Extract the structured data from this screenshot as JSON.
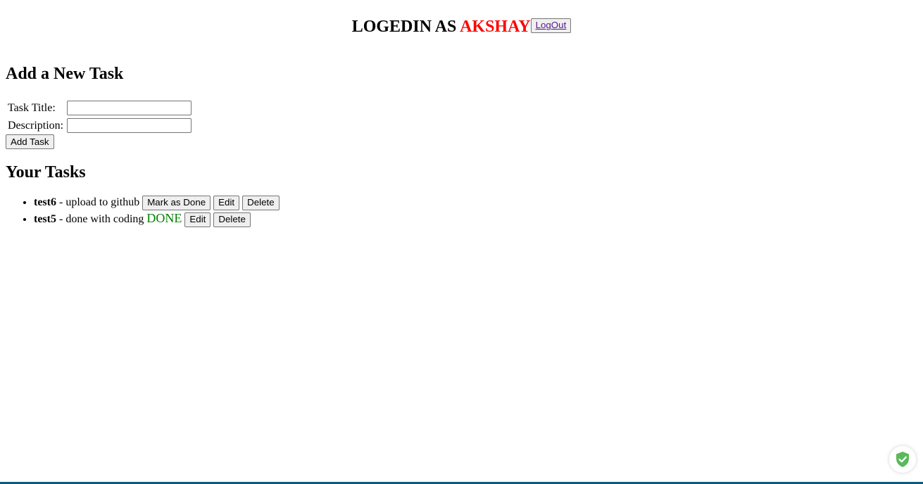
{
  "header": {
    "prefix": "LOGEDIN AS ",
    "username": "AKSHAY",
    "logout_label": "LogOut"
  },
  "add_task": {
    "heading": "Add a New Task",
    "title_label": "Task Title:",
    "title_value": "",
    "description_label": "Description:",
    "description_value": "",
    "submit_label": "Add Task"
  },
  "tasks": {
    "heading": "Your Tasks",
    "items": [
      {
        "title": "test6",
        "separator": " - ",
        "description": "upload to github",
        "status": "",
        "mark_done_label": "Mark as Done",
        "edit_label": "Edit",
        "delete_label": "Delete"
      },
      {
        "title": "test5",
        "separator": " - ",
        "description": "done with coding",
        "status": "DONE",
        "edit_label": "Edit",
        "delete_label": "Delete"
      }
    ]
  },
  "colors": {
    "username": "#ff0000",
    "done_status": "#008000",
    "shield": "#5cb85c",
    "bottom_border": "#0d5a78"
  },
  "icons": {
    "security_badge": "shield-check-icon"
  }
}
